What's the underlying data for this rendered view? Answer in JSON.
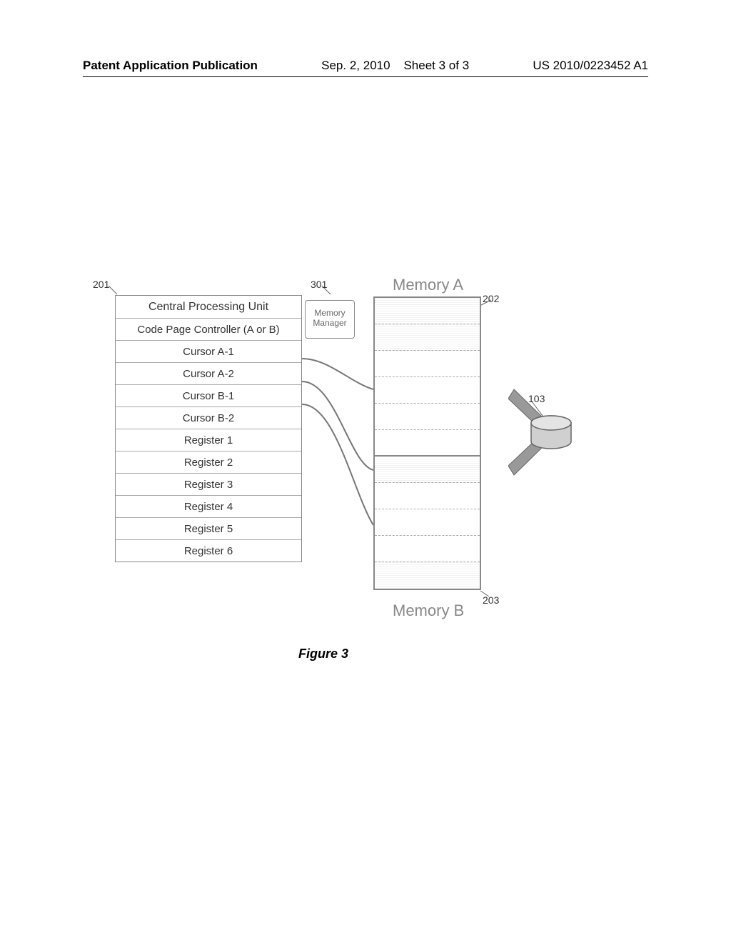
{
  "header": {
    "pub_label": "Patent Application Publication",
    "pub_date": "Sep. 2, 2010",
    "sheet": "Sheet 3 of 3",
    "pub_number": "US 2010/0223452 A1"
  },
  "refs": {
    "r201": "201",
    "r301": "301",
    "r202": "202",
    "r203": "203",
    "r103": "103"
  },
  "cpu": {
    "title": "Central Processing Unit",
    "rows": [
      "Code Page Controller (A or B)",
      "Cursor A-1",
      "Cursor A-2",
      "Cursor B-1",
      "Cursor B-2",
      "Register 1",
      "Register 2",
      "Register 3",
      "Register 4",
      "Register 5",
      "Register 6"
    ]
  },
  "mem_manager": {
    "line1": "Memory",
    "line2": "Manager"
  },
  "memory": {
    "a_title": "Memory A",
    "b_title": "Memory B",
    "cells_count": 11,
    "mid_split_after": 5,
    "highlight": [
      0,
      1,
      6,
      10
    ]
  },
  "caption": "Figure 3"
}
